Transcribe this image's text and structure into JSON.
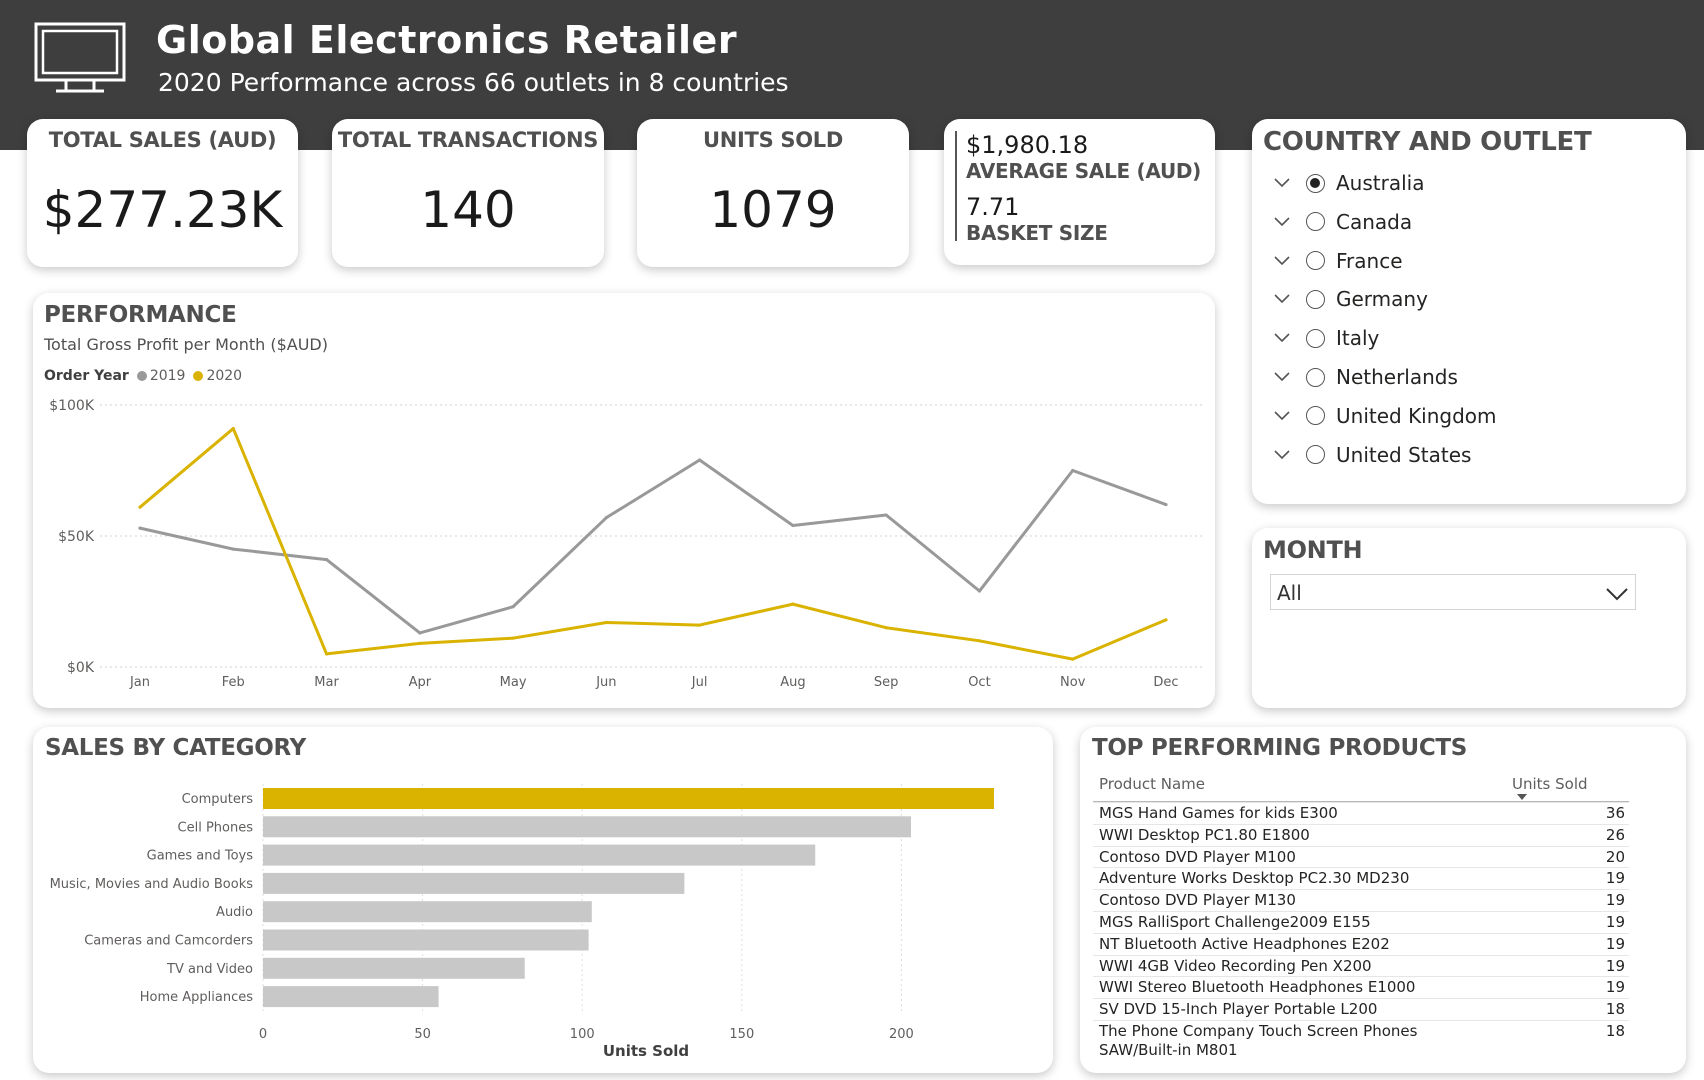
{
  "header": {
    "title": "Global Electronics Retailer",
    "subtitle": "2020 Performance across 66 outlets in 8 countries",
    "icon": "monitor-icon"
  },
  "kpis": [
    {
      "label": "TOTAL SALES (AUD)",
      "value": "$277.23K"
    },
    {
      "label": "TOTAL TRANSACTIONS",
      "value": "140"
    },
    {
      "label": "UNITS SOLD",
      "value": "1079"
    }
  ],
  "multi_card": {
    "value1": "$1,980.18",
    "label1": "AVERAGE SALE (AUD)",
    "value2": "7.71",
    "label2": "BASKET SIZE"
  },
  "performance": {
    "title": "PERFORMANCE",
    "subtitle": "Total Gross Profit per Month ($AUD)",
    "legend_title": "Order Year"
  },
  "country_slicer": {
    "title": "COUNTRY AND OUTLET",
    "items": [
      {
        "label": "Australia",
        "selected": true
      },
      {
        "label": "Canada",
        "selected": false
      },
      {
        "label": "France",
        "selected": false
      },
      {
        "label": "Germany",
        "selected": false
      },
      {
        "label": "Italy",
        "selected": false
      },
      {
        "label": "Netherlands",
        "selected": false
      },
      {
        "label": "United Kingdom",
        "selected": false
      },
      {
        "label": "United States",
        "selected": false
      }
    ]
  },
  "month_slicer": {
    "title": "MONTH",
    "value": "All"
  },
  "sales_by_category": {
    "title": "SALES BY CATEGORY"
  },
  "top_products": {
    "title": "TOP PERFORMING PRODUCTS",
    "columns": [
      "Product Name",
      "Units Sold"
    ],
    "rows": [
      {
        "name": "MGS Hand Games for kids E300",
        "units": "36"
      },
      {
        "name": "WWI Desktop PC1.80 E1800",
        "units": "26"
      },
      {
        "name": "Contoso DVD Player M100",
        "units": "20"
      },
      {
        "name": "Adventure Works Desktop PC2.30 MD230",
        "units": "19"
      },
      {
        "name": "Contoso DVD Player M130",
        "units": "19"
      },
      {
        "name": "MGS RalliSport Challenge2009 E155",
        "units": "19"
      },
      {
        "name": "NT Bluetooth Active Headphones E202",
        "units": "19"
      },
      {
        "name": "WWI 4GB Video Recording Pen X200",
        "units": "19"
      },
      {
        "name": "WWI Stereo Bluetooth Headphones E1000",
        "units": "19"
      },
      {
        "name": "SV DVD 15-Inch Player Portable L200",
        "units": "18"
      },
      {
        "name": "The Phone Company Touch Screen Phones SAW/Built-in M801",
        "units": "18"
      }
    ]
  },
  "colors": {
    "header_bg": "#3e3e3e",
    "series_2019": "#999999",
    "series_2020": "#d9b300",
    "bar_highlight": "#d9b300",
    "bar_default": "#c8c8c8"
  },
  "chart_data": [
    {
      "type": "line",
      "x": [
        "Jan",
        "Feb",
        "Mar",
        "Apr",
        "May",
        "Jun",
        "Jul",
        "Aug",
        "Sep",
        "Oct",
        "Nov",
        "Dec"
      ],
      "series": [
        {
          "name": "2019",
          "values": [
            53000,
            45000,
            41000,
            13000,
            23000,
            57000,
            79000,
            54000,
            58000,
            29000,
            75000,
            62000
          ]
        },
        {
          "name": "2020",
          "values": [
            61000,
            91000,
            5000,
            9000,
            11000,
            17000,
            16000,
            24000,
            15000,
            10000,
            3000,
            18000
          ]
        }
      ],
      "y_ticks": [
        "$0K",
        "$50K",
        "$100K"
      ],
      "y_tick_values": [
        0,
        50000,
        100000
      ],
      "ylim": [
        0,
        100000
      ],
      "grid": true,
      "legend_placement": "top-left"
    },
    {
      "type": "bar",
      "orientation": "horizontal",
      "categories": [
        "Computers",
        "Cell Phones",
        "Games and Toys",
        "Music, Movies and Audio Books",
        "Audio",
        "Cameras and Camcorders",
        "TV and Video",
        "Home Appliances"
      ],
      "values": [
        229,
        203,
        173,
        132,
        103,
        102,
        82,
        55
      ],
      "xlabel": "Units Sold",
      "x_ticks": [
        0,
        50,
        100,
        150,
        200
      ],
      "xlim": [
        0,
        229
      ],
      "grid": true,
      "highlighted": "Computers"
    }
  ]
}
